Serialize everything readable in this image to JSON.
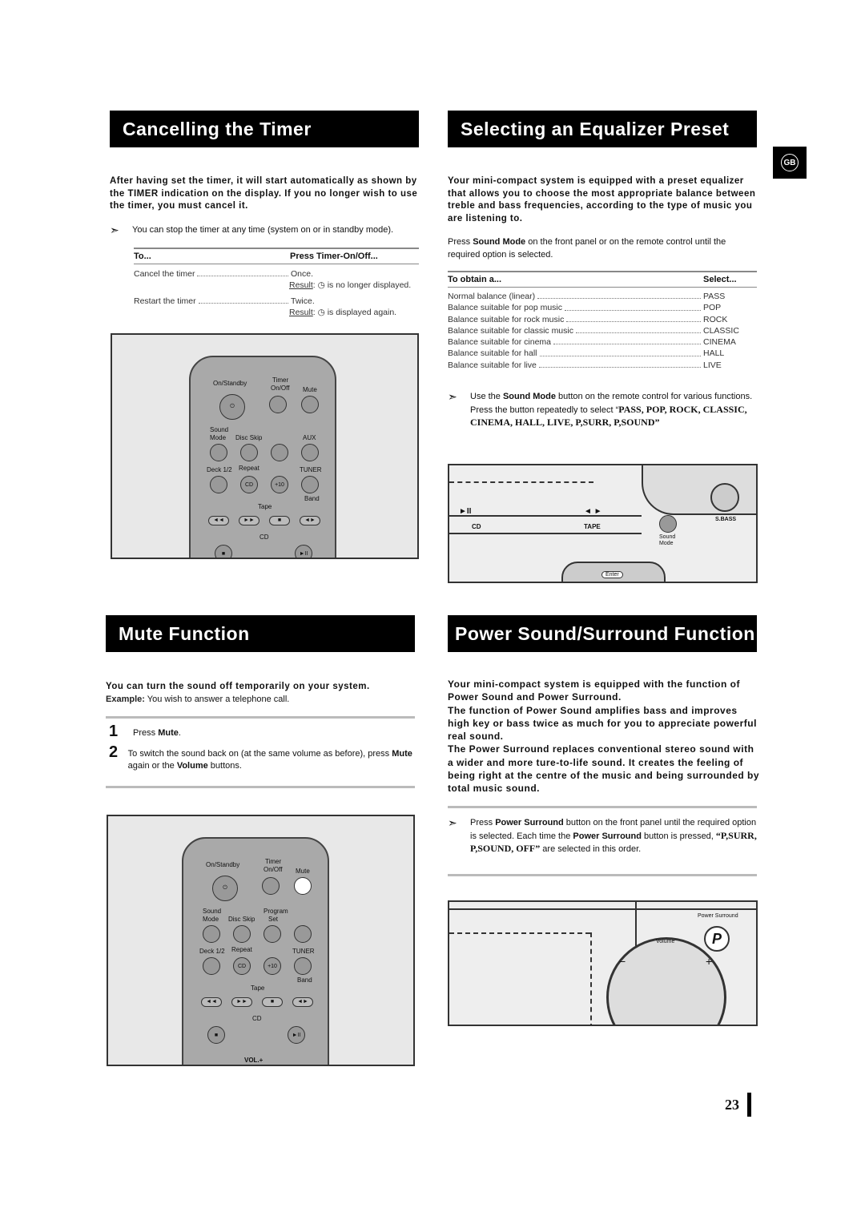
{
  "badge": "GB",
  "page_number": "23",
  "timer": {
    "title": "Cancelling the Timer",
    "lead": "After having set the timer, it will start automatically as shown by the TIMER indication on the display. If you no longer wish to use the timer, you must cancel it.",
    "note": "You can stop the timer at any time (system on or in standby mode).",
    "col1": "To...",
    "col2": "Press Timer-On/Off...",
    "rows": [
      {
        "action": "Cancel the timer",
        "press": "Once.",
        "result_label": "Result",
        "result": "is no longer displayed."
      },
      {
        "action": "Restart the timer",
        "press": "Twice.",
        "result_label": "Result",
        "result": "is displayed again."
      }
    ]
  },
  "remote": {
    "on_standby": "On/Standby",
    "timer": "Timer",
    "on_off": "On/Off",
    "mute": "Mute",
    "sound": "Sound",
    "mode": "Mode",
    "disc_skip": "Disc Skip",
    "program": "Program",
    "set": "Set",
    "aux": "AUX",
    "deck": "Deck 1/2",
    "repeat": "Repeat",
    "tuner": "TUNER",
    "cd": "CD",
    "plus10": "+10",
    "band": "Band",
    "tape": "Tape",
    "vol": "VOL.+"
  },
  "eq": {
    "title": "Selecting an Equalizer Preset",
    "lead": "Your mini-compact system is equipped with a preset equalizer that allows you to choose the most appropriate balance between treble and bass frequencies, according to the type of music you are listening to.",
    "press_pre": "Press ",
    "press_bold": "Sound Mode",
    "press_post": " on the front panel or on the remote control until the required option is selected.",
    "col1": "To obtain a...",
    "col2": "Select...",
    "rows": [
      {
        "label": "Normal balance (linear)",
        "value": "PASS"
      },
      {
        "label": "Balance suitable for pop music",
        "value": "POP"
      },
      {
        "label": "Balance suitable for rock music",
        "value": "ROCK"
      },
      {
        "label": "Balance suitable for classic music",
        "value": "CLASSIC"
      },
      {
        "label": "Balance suitable for cinema",
        "value": "CINEMA"
      },
      {
        "label": "Balance suitable for hall",
        "value": "HALL"
      },
      {
        "label": "Balance suitable for live",
        "value": "LIVE"
      }
    ],
    "note_pre": "Use the ",
    "note_bold": "Sound Mode",
    "note_post": " button on the remote control for various functions.",
    "note2": "Press the button repeatedly to select “",
    "note2_serif": "PASS, POP, ROCK, CLASSIC, CINEMA, HALL, LIVE, P,SURR, P,SOUND”",
    "panel": {
      "play": "►II",
      "skip": "◄ ►",
      "cd": "CD",
      "tape": "TAPE",
      "sbass": "S.BASS",
      "sound_mode": "Sound Mode",
      "enter": "Enter"
    }
  },
  "mute": {
    "title": "Mute Function",
    "lead": "You can turn the sound off temporarily on your system.",
    "example_label": "Example:",
    "example": " You wish to answer a telephone call.",
    "steps": [
      {
        "n": "1",
        "pre": "Press ",
        "bold": "Mute",
        "post": "."
      },
      {
        "n": "2",
        "pre": "To switch the sound back on (at the same volume as before), press ",
        "bold": "Mute",
        "mid": " again or the ",
        "bold2": "Volume",
        "post": " buttons."
      }
    ]
  },
  "power": {
    "title": "Power Sound/Surround Function",
    "lead": "Your mini-compact system is equipped with the function of Power Sound and Power Surround.",
    "lead2": "The function of Power Sound amplifies bass and improves high key or bass twice as much for you to appreciate powerful real sound.",
    "lead3": "The Power Surround replaces conventional stereo sound with a wider and more ture-to-life sound. It creates the feeling of being right at the centre of the music and being surrounded by total music sound.",
    "note_pre": "Press ",
    "note_bold": "Power Surround",
    "note_mid": " button on the front panel until the required option is selected. Each time the ",
    "note_bold2": "Power Surround",
    "note_mid2": " button is pressed, ",
    "note_serif": "“P,SURR, P,SOUND, OFF”",
    "note_post": " are selected in this order.",
    "panel": {
      "power_surround": "Power Surround",
      "volume": "Volume",
      "p": "P",
      "minus": "−",
      "plus": "+"
    }
  }
}
